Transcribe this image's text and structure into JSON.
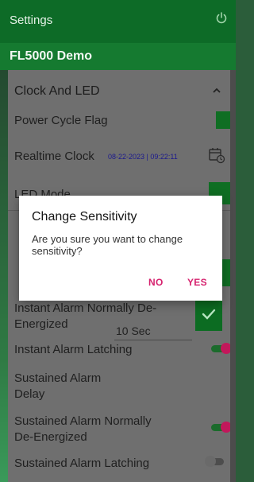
{
  "app": {
    "title": "Settings",
    "device_name": "FL5000 Demo"
  },
  "section": {
    "title": "Clock And LED"
  },
  "rows": {
    "power_cycle_flag": "Power Cycle Flag",
    "realtime_clock": "Realtime Clock",
    "realtime_clock_value": "08-22-2023 | 09:22:11",
    "led_mode": "LED Mode",
    "instant_alarm_normally_de_energized": "Instant Alarm Normally De-Energized",
    "instant_alarm_latching": "Instant Alarm Latching",
    "sustained_alarm_delay": "Sustained Alarm Delay",
    "sustained_alarm_delay_value": "10 Sec",
    "sustained_alarm_normally_de_energized": "Sustained Alarm Normally De-Energized",
    "sustained_alarm_latching": "Sustained Alarm Latching"
  },
  "toggles": {
    "instant_alarm_normally_de_energized": false,
    "instant_alarm_latching": true,
    "sustained_alarm_normally_de_energized": true,
    "sustained_alarm_latching": false
  },
  "dialog": {
    "title": "Change Sensitivity",
    "message": "Are you sure you want to change sensitivity?",
    "no_label": "NO",
    "yes_label": "YES"
  },
  "colors": {
    "app_bar": "#0d6b27",
    "sub_bar": "#157a30",
    "accent": "#d6226e",
    "toggle_on": "#c2185b"
  },
  "icons": {
    "power": "power-icon",
    "chevron": "chevron-up-icon",
    "calendar": "calendar-clock-icon",
    "check": "check-icon"
  }
}
